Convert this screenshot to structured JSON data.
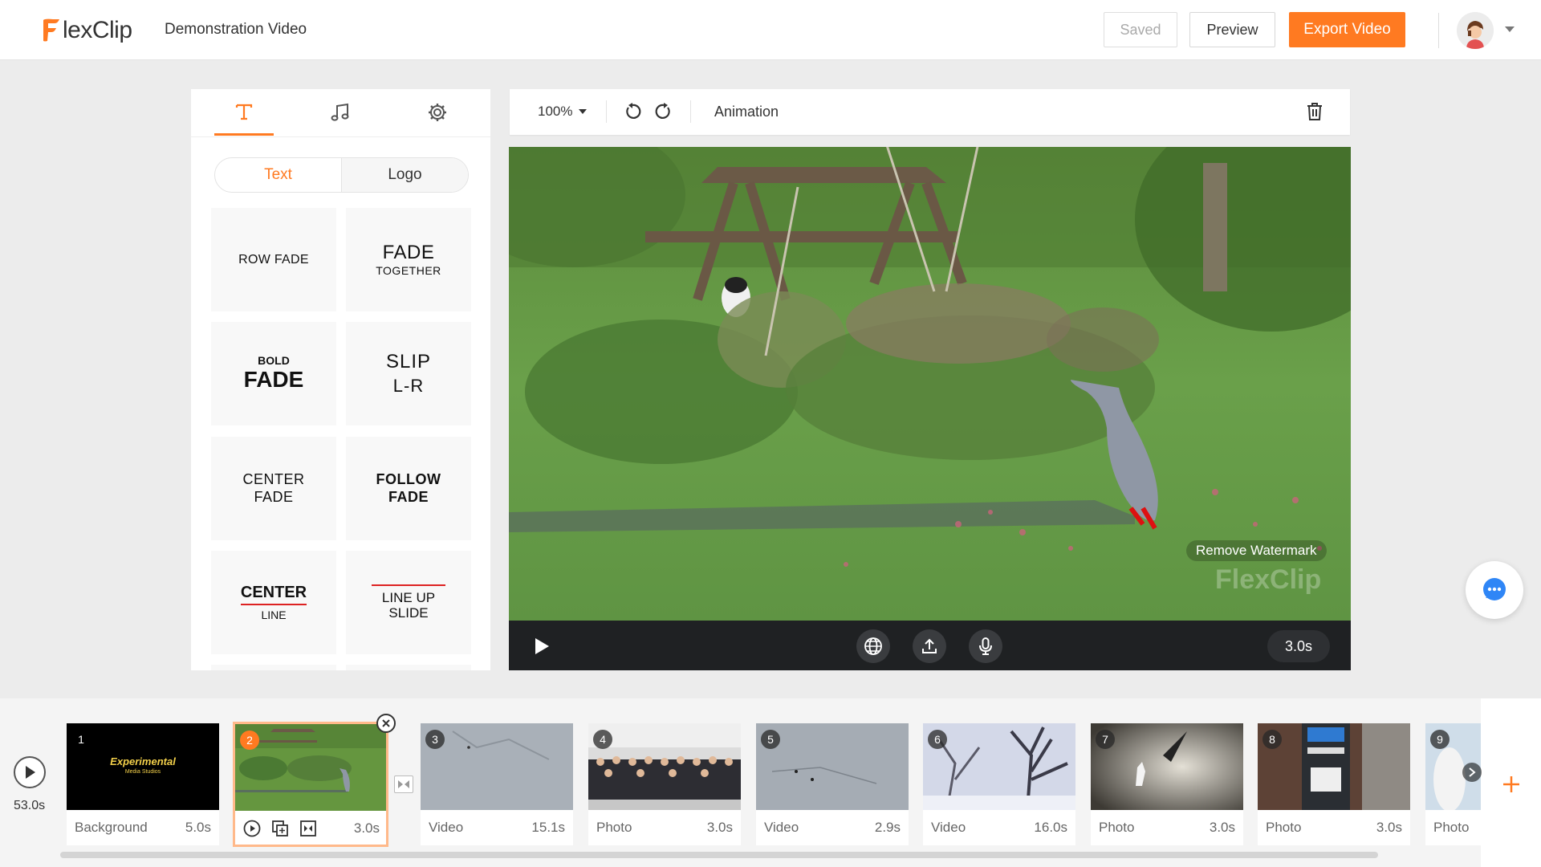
{
  "header": {
    "logo_text": "lexClip",
    "project_title": "Demonstration Video",
    "saved_label": "Saved",
    "preview_label": "Preview",
    "export_label": "Export Video",
    "brand_color": "#ff7a21"
  },
  "left_panel": {
    "tabs": [
      {
        "icon": "text-icon",
        "active": true
      },
      {
        "icon": "music-note-icon",
        "active": false
      },
      {
        "icon": "gear-icon",
        "active": false
      }
    ],
    "segments": {
      "text": "Text",
      "logo": "Logo"
    },
    "cards": [
      {
        "line1": "ROW FADE",
        "line2": ""
      },
      {
        "line1": "FADE",
        "line2": "TOGETHER"
      },
      {
        "line1": "BOLD",
        "line2": "FADE"
      },
      {
        "line1": "SLIP",
        "line2": "L-R"
      },
      {
        "line1": "CENTER",
        "line2": "FADE"
      },
      {
        "line1": "FOLLOW",
        "line2": "FADE"
      },
      {
        "line1": "CENTER",
        "line2": "LINE"
      },
      {
        "line1": "LINE UP",
        "line2": "SLIDE"
      }
    ]
  },
  "toolbar": {
    "zoom": "100%",
    "animation_label": "Animation"
  },
  "canvas": {
    "watermark_button": "Remove Watermark",
    "watermark_text": "FlexClip",
    "duration": "3.0s"
  },
  "timeline": {
    "total_duration": "53.0s",
    "clips": [
      {
        "num": "1",
        "label": "Background",
        "duration": "5.0s",
        "thumb_title": "Experimental",
        "thumb_sub": "Media Studios"
      },
      {
        "num": "2",
        "label": "",
        "duration": "3.0s",
        "selected": true
      },
      {
        "num": "3",
        "label": "Video",
        "duration": "15.1s"
      },
      {
        "num": "4",
        "label": "Photo",
        "duration": "3.0s"
      },
      {
        "num": "5",
        "label": "Video",
        "duration": "2.9s"
      },
      {
        "num": "6",
        "label": "Video",
        "duration": "16.0s"
      },
      {
        "num": "7",
        "label": "Photo",
        "duration": "3.0s"
      },
      {
        "num": "8",
        "label": "Photo",
        "duration": "3.0s"
      },
      {
        "num": "9",
        "label": "Photo",
        "duration": ""
      }
    ]
  }
}
